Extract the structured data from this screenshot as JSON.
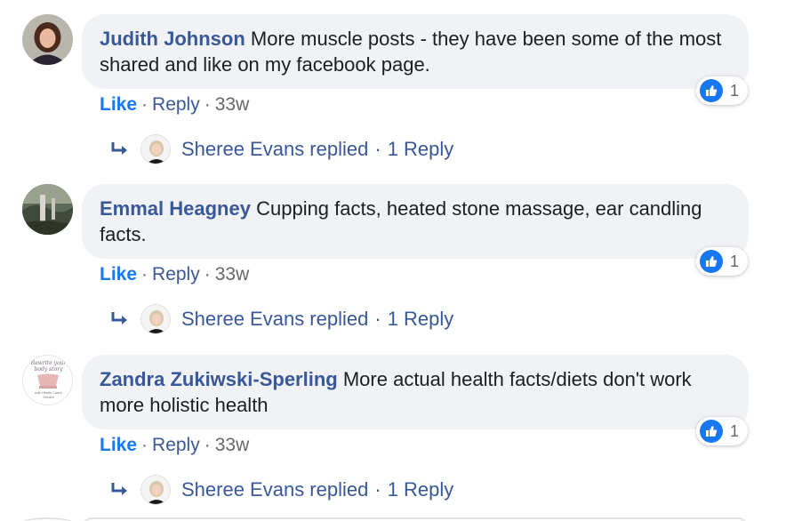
{
  "comments": [
    {
      "author": "Judith Johnson",
      "text": "More muscle posts - they have been some of the most shared and like on my facebook page.",
      "like_label": "Like",
      "reply_label": "Reply",
      "time": "33w",
      "reaction_count": "1",
      "replied_by": "Sheree Evans replied",
      "reply_count_label": "1 Reply"
    },
    {
      "author": "Emmal Heagney",
      "text": "Cupping facts, heated stone massage, ear candling facts.",
      "like_label": "Like",
      "reply_label": "Reply",
      "time": "33w",
      "reaction_count": "1",
      "replied_by": "Sheree Evans replied",
      "reply_count_label": "1 Reply"
    },
    {
      "author": "Zandra Zukiwski-Sperling",
      "text": "More actual health facts/diets don't work more holistic health",
      "like_label": "Like",
      "reply_label": "Reply",
      "time": "33w",
      "reaction_count": "1",
      "replied_by": "Sheree Evans replied",
      "reply_count_label": "1 Reply",
      "avatar_logo_text": "Rewrite your body story with Health Coach Zandra"
    }
  ],
  "icons": {
    "reaction": "thumbs-up-icon",
    "replies": "reply-arrow-icon"
  },
  "colors": {
    "author": "#385898",
    "like": "#1877f2",
    "bubble": "#f0f2f5",
    "meta": "#65676b"
  }
}
